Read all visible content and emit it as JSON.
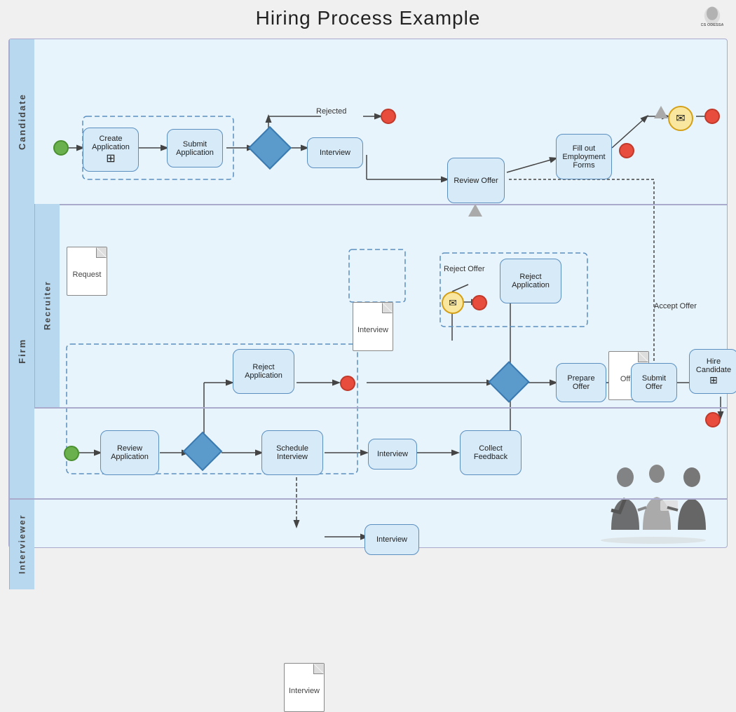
{
  "title": "Hiring Process Example",
  "logo": {
    "text": "CS ODESSA",
    "icon": "💠"
  },
  "swimlanes": {
    "candidate": "Candidate",
    "firm": "Firm",
    "recruiter": "Recruiter",
    "interviewer": "Interviewer"
  },
  "nodes": {
    "create_application": "Create Application",
    "submit_application": "Submit Application",
    "interview_candidate": "Interview",
    "rejected": "Rejected",
    "review_offer": "Review Offer",
    "fill_out_forms": "Fill out Employment Forms",
    "request": "Request",
    "interview_artifact_top": "Interview",
    "reject_offer": "Reject Offer",
    "reject_application_1": "Reject Application",
    "offer_artifact": "Offer",
    "accept_offer": "Accept Offer",
    "review_application": "Review Application",
    "reject_application_2": "Reject Application",
    "schedule_interview": "Schedule Interview",
    "interview_firm": "Interview",
    "collect_feedback": "Collect Feedback",
    "prepare_offer": "Prepare Offer",
    "submit_offer": "Submit Offer",
    "hire_candidate": "Hire Candidate",
    "interview_artifact_bottom": "Interview",
    "interview_interviewer": "Interview"
  },
  "colors": {
    "swimlane_bg": "#daeef8",
    "swimlane_label_bg": "#b8d8ef",
    "node_fill": "#d6eaf8",
    "node_border": "#5a8fc0",
    "diamond_fill": "#5a9bcc",
    "start_fill": "#6ab04c",
    "end_fill": "#e74c3c",
    "envelope_fill": "#f9e79f"
  }
}
